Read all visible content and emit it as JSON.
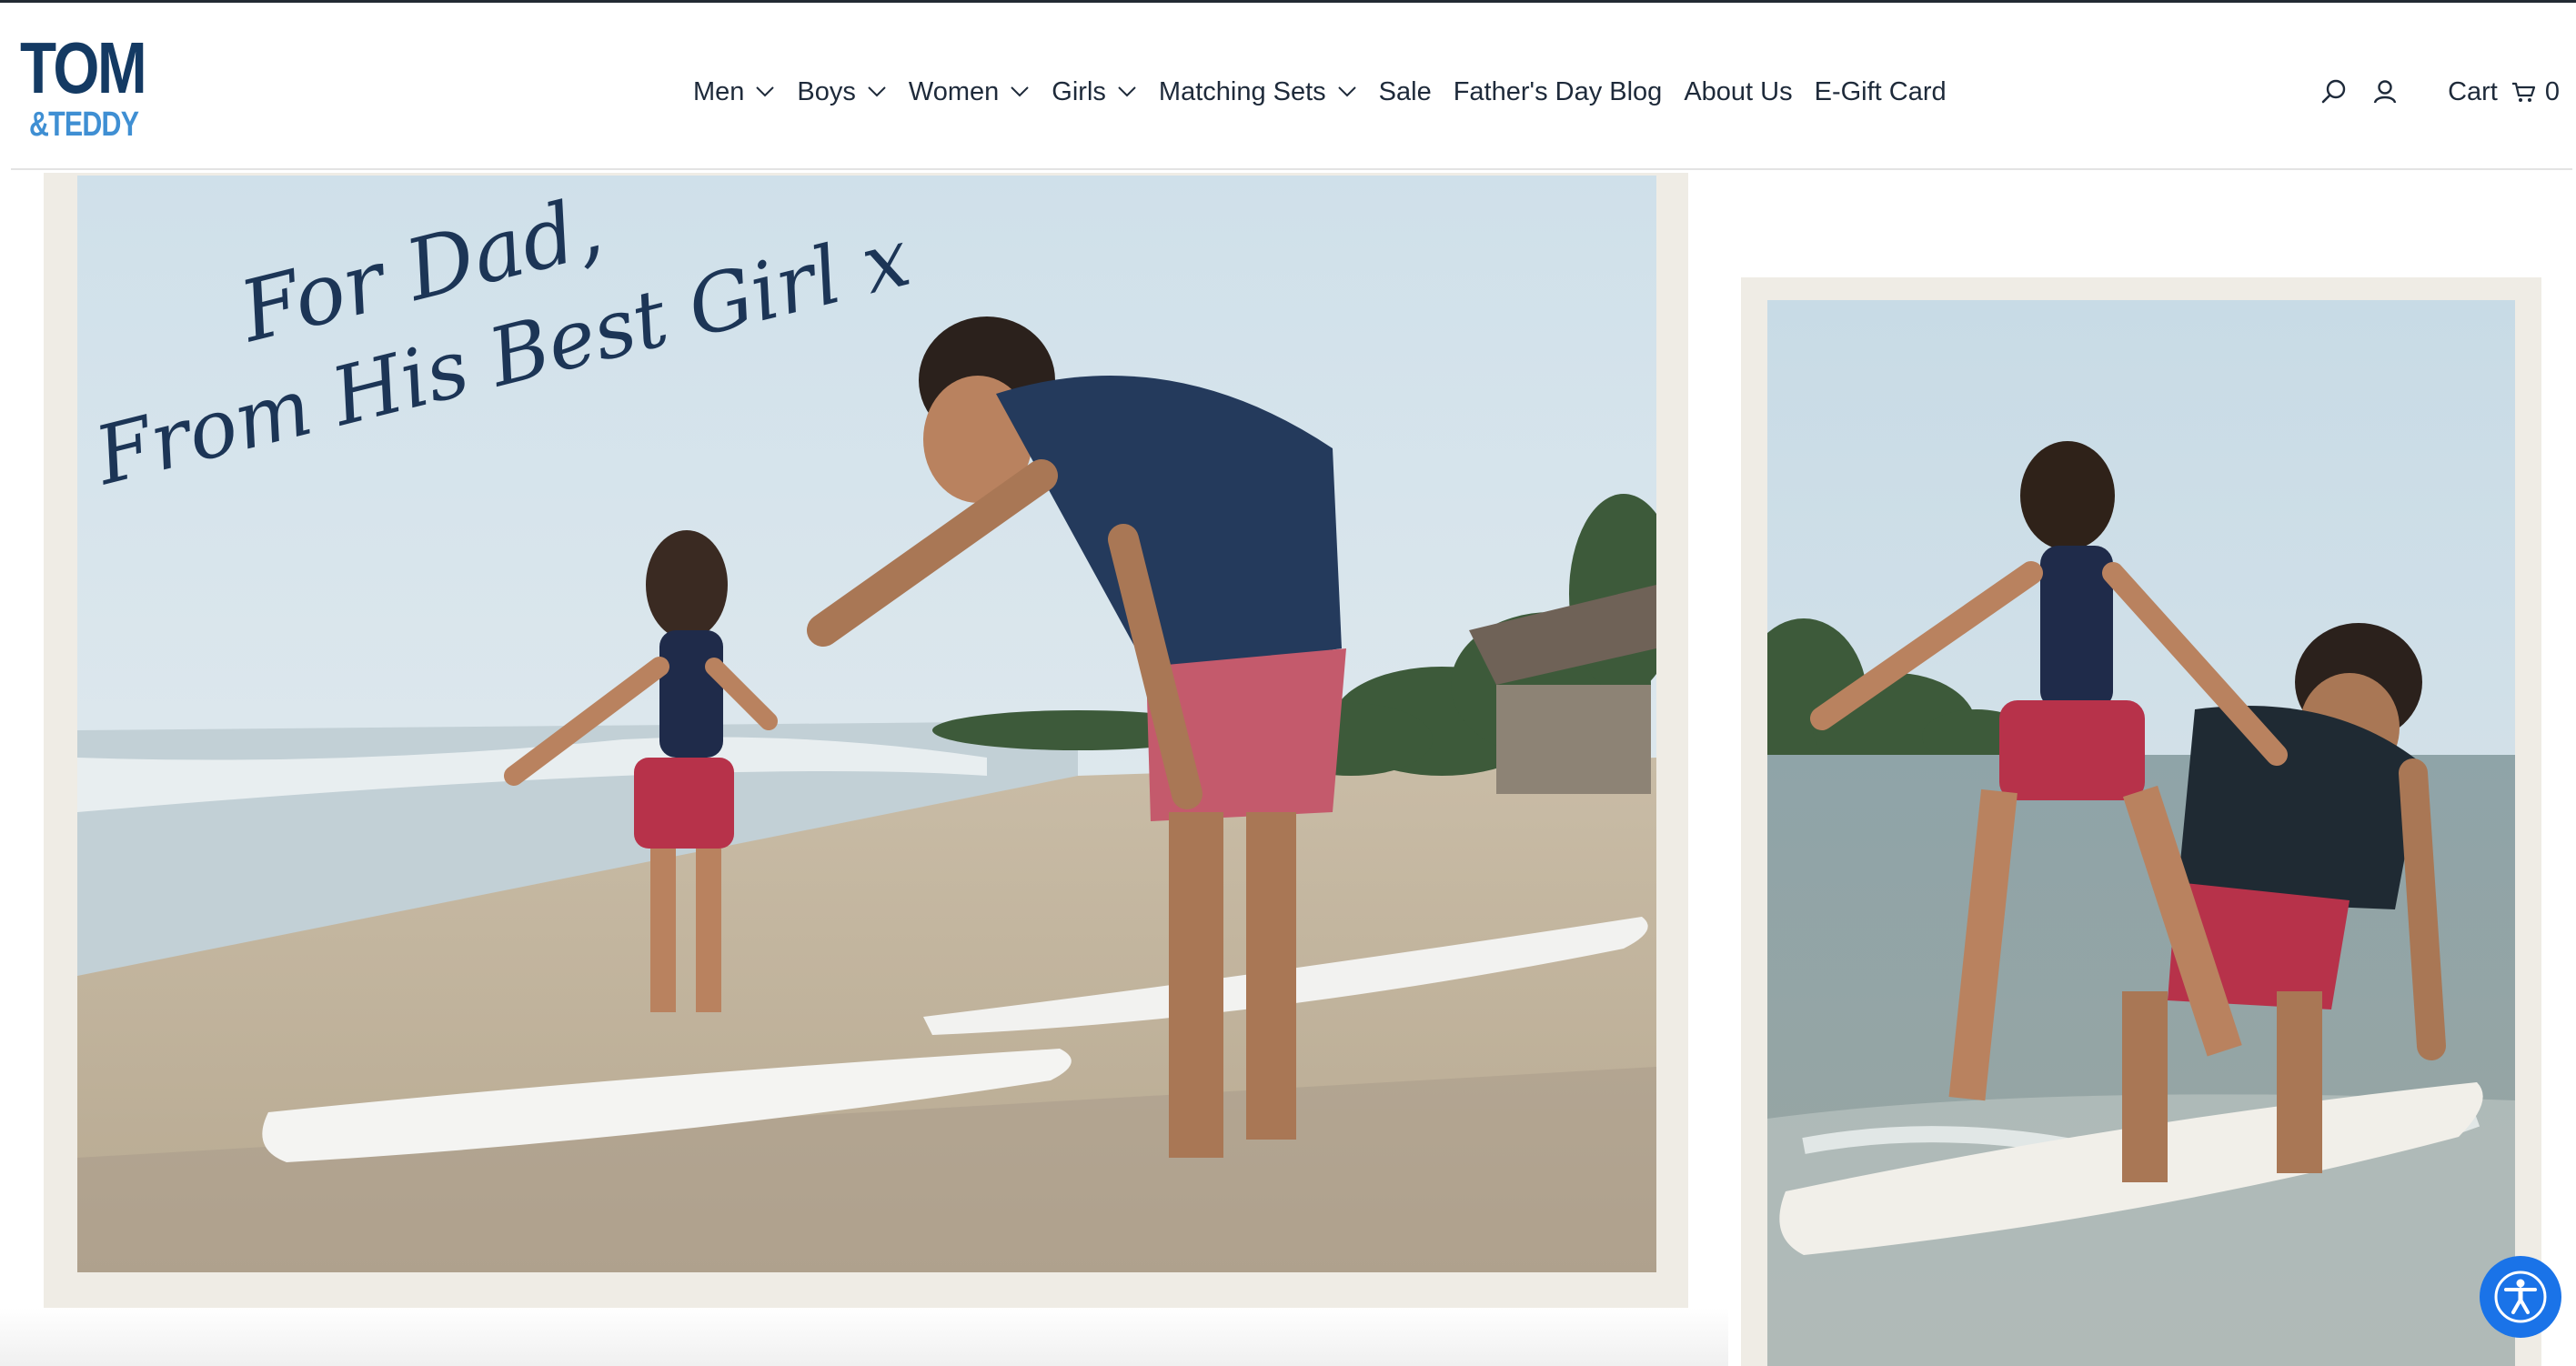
{
  "brand": {
    "logo_top": "TOM",
    "logo_bottom": "&TEDDY"
  },
  "nav": {
    "items": [
      {
        "label": "Men",
        "has_dropdown": true
      },
      {
        "label": "Boys",
        "has_dropdown": true
      },
      {
        "label": "Women",
        "has_dropdown": true
      },
      {
        "label": "Girls",
        "has_dropdown": true
      },
      {
        "label": "Matching Sets",
        "has_dropdown": true
      },
      {
        "label": "Sale",
        "has_dropdown": false
      },
      {
        "label": "Father's Day Blog",
        "has_dropdown": false
      },
      {
        "label": "About Us",
        "has_dropdown": false
      },
      {
        "label": "E-Gift Card",
        "has_dropdown": false
      }
    ]
  },
  "header_utils": {
    "search_icon": "search-icon",
    "account_icon": "account-icon",
    "cart_label": "Cart",
    "cart_icon": "cart-icon",
    "cart_count": "0"
  },
  "hero": {
    "handwritten_line1": "For Dad,",
    "handwritten_line2": "From His Best Girl x"
  },
  "accessibility": {
    "icon": "accessibility-icon"
  },
  "colors": {
    "brand_navy": "#143a63",
    "brand_blue": "#3f8fd3",
    "accessibility_blue": "#1a73e8"
  }
}
